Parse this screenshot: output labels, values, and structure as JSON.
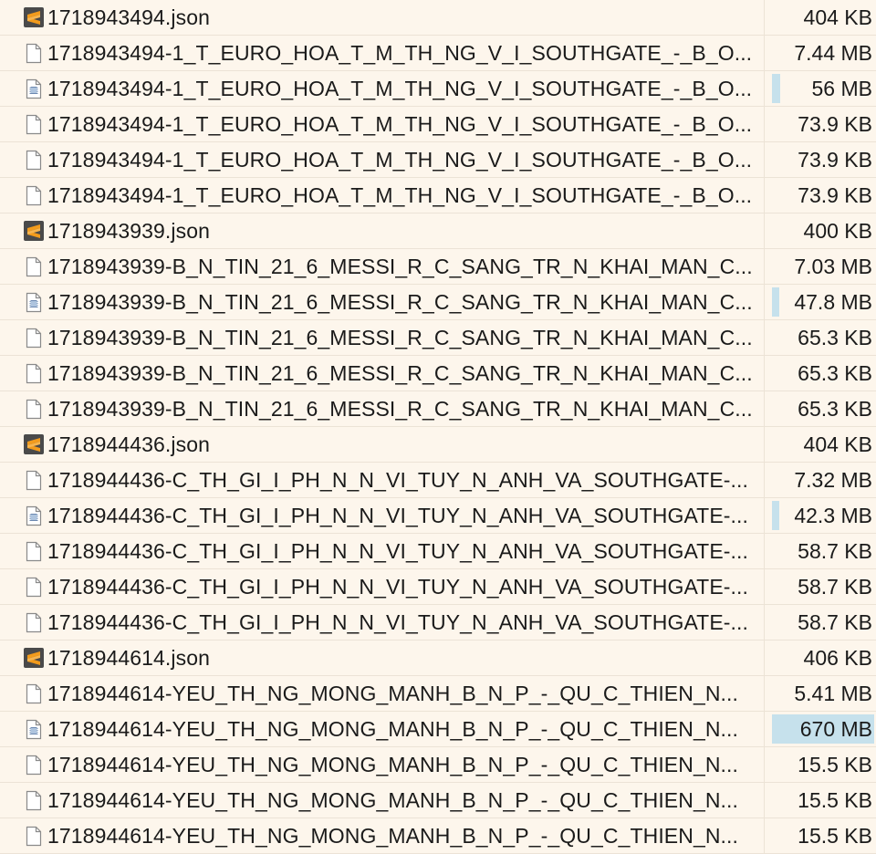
{
  "rows": [
    {
      "icon": "sublime-json-icon",
      "name": "1718943494.json",
      "size": "404 KB",
      "bar": 0
    },
    {
      "icon": "file-icon",
      "name": "1718943494-1_T_EURO_HOA_T_M_TH_NG_V_I_SOUTHGATE_-_B_O...",
      "size": "7.44 MB",
      "bar": 0
    },
    {
      "icon": "video-file-icon",
      "name": "1718943494-1_T_EURO_HOA_T_M_TH_NG_V_I_SOUTHGATE_-_B_O...",
      "size": "56 MB",
      "bar": 0.084
    },
    {
      "icon": "file-icon",
      "name": "1718943494-1_T_EURO_HOA_T_M_TH_NG_V_I_SOUTHGATE_-_B_O...",
      "size": "73.9 KB",
      "bar": 0
    },
    {
      "icon": "file-icon",
      "name": "1718943494-1_T_EURO_HOA_T_M_TH_NG_V_I_SOUTHGATE_-_B_O...",
      "size": "73.9 KB",
      "bar": 0
    },
    {
      "icon": "file-icon",
      "name": "1718943494-1_T_EURO_HOA_T_M_TH_NG_V_I_SOUTHGATE_-_B_O...",
      "size": "73.9 KB",
      "bar": 0
    },
    {
      "icon": "sublime-json-icon",
      "name": "1718943939.json",
      "size": "400 KB",
      "bar": 0
    },
    {
      "icon": "file-icon",
      "name": "1718943939-B_N_TIN_21_6_MESSI_R_C_SANG_TR_N_KHAI_MAN_C...",
      "size": "7.03 MB",
      "bar": 0
    },
    {
      "icon": "video-file-icon",
      "name": "1718943939-B_N_TIN_21_6_MESSI_R_C_SANG_TR_N_KHAI_MAN_C...",
      "size": "47.8 MB",
      "bar": 0.071
    },
    {
      "icon": "file-icon",
      "name": "1718943939-B_N_TIN_21_6_MESSI_R_C_SANG_TR_N_KHAI_MAN_C...",
      "size": "65.3 KB",
      "bar": 0
    },
    {
      "icon": "file-icon",
      "name": "1718943939-B_N_TIN_21_6_MESSI_R_C_SANG_TR_N_KHAI_MAN_C...",
      "size": "65.3 KB",
      "bar": 0
    },
    {
      "icon": "file-icon",
      "name": "1718943939-B_N_TIN_21_6_MESSI_R_C_SANG_TR_N_KHAI_MAN_C...",
      "size": "65.3 KB",
      "bar": 0
    },
    {
      "icon": "sublime-json-icon",
      "name": "1718944436.json",
      "size": "404 KB",
      "bar": 0
    },
    {
      "icon": "file-icon",
      "name": "1718944436-C_TH_GI_I_PH_N_N_VI_TUY_N_ANH_VA_SOUTHGATE-...",
      "size": "7.32 MB",
      "bar": 0
    },
    {
      "icon": "video-file-icon",
      "name": "1718944436-C_TH_GI_I_PH_N_N_VI_TUY_N_ANH_VA_SOUTHGATE-...",
      "size": "42.3 MB",
      "bar": 0.063
    },
    {
      "icon": "file-icon",
      "name": "1718944436-C_TH_GI_I_PH_N_N_VI_TUY_N_ANH_VA_SOUTHGATE-...",
      "size": "58.7 KB",
      "bar": 0
    },
    {
      "icon": "file-icon",
      "name": "1718944436-C_TH_GI_I_PH_N_N_VI_TUY_N_ANH_VA_SOUTHGATE-...",
      "size": "58.7 KB",
      "bar": 0
    },
    {
      "icon": "file-icon",
      "name": "1718944436-C_TH_GI_I_PH_N_N_VI_TUY_N_ANH_VA_SOUTHGATE-...",
      "size": "58.7 KB",
      "bar": 0
    },
    {
      "icon": "sublime-json-icon",
      "name": "1718944614.json",
      "size": "406 KB",
      "bar": 0
    },
    {
      "icon": "file-icon",
      "name": "1718944614-YEU_TH_NG_MONG_MANH_B_N_P_-_QU_C_THIEN_N...",
      "size": "5.41 MB",
      "bar": 0
    },
    {
      "icon": "video-file-icon",
      "name": "1718944614-YEU_TH_NG_MONG_MANH_B_N_P_-_QU_C_THIEN_N...",
      "size": "670 MB",
      "bar": 1.0
    },
    {
      "icon": "file-icon",
      "name": "1718944614-YEU_TH_NG_MONG_MANH_B_N_P_-_QU_C_THIEN_N...",
      "size": "15.5 KB",
      "bar": 0
    },
    {
      "icon": "file-icon",
      "name": "1718944614-YEU_TH_NG_MONG_MANH_B_N_P_-_QU_C_THIEN_N...",
      "size": "15.5 KB",
      "bar": 0
    },
    {
      "icon": "file-icon",
      "name": "1718944614-YEU_TH_NG_MONG_MANH_B_N_P_-_QU_C_THIEN_N...",
      "size": "15.5 KB",
      "bar": 0
    }
  ],
  "colors": {
    "background": "#fdf6ec",
    "size_bar": "#c6e1ec",
    "sublime_orange": "#f29b1c",
    "sublime_dark": "#4a4a4a"
  }
}
